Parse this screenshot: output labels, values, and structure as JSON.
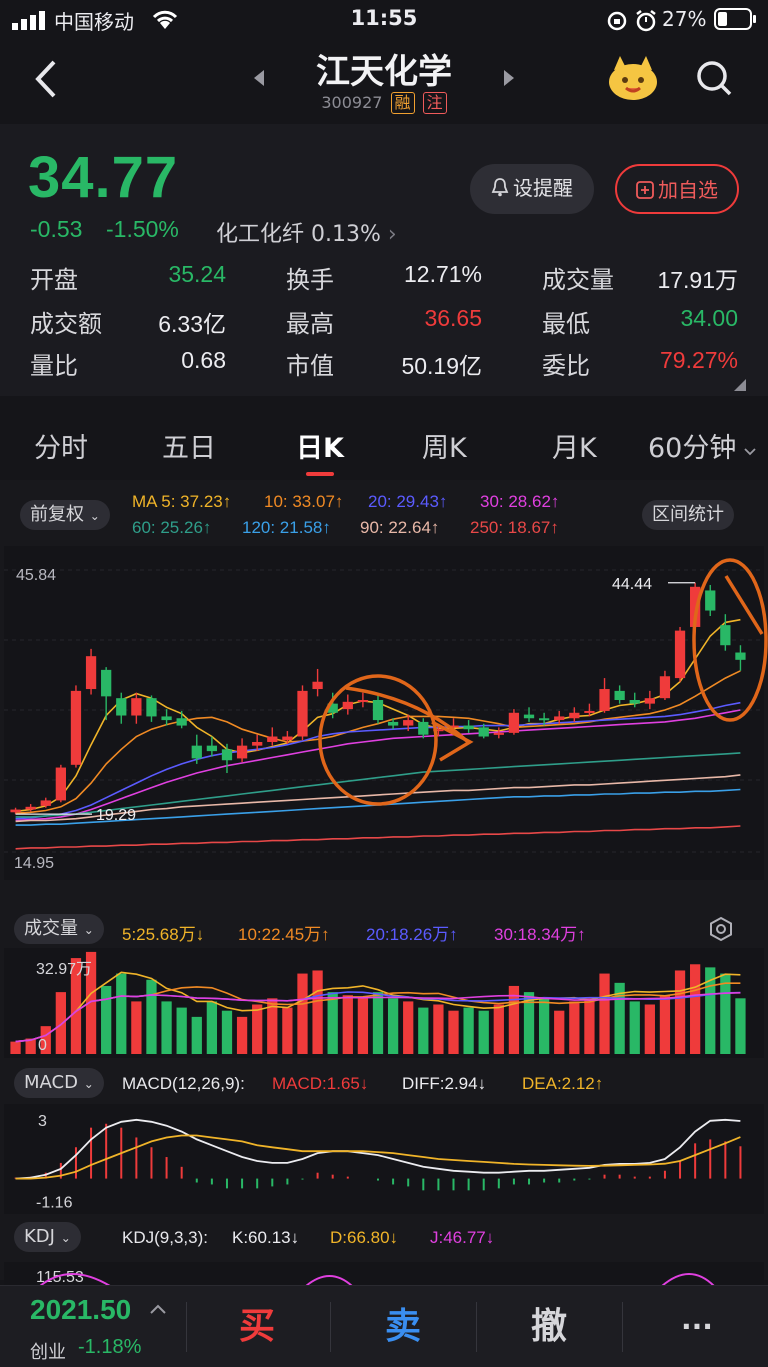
{
  "status_bar": {
    "carrier": "中国移动",
    "time": "11:55",
    "battery": "27%"
  },
  "header": {
    "title": "江天化学",
    "code": "300927",
    "tag_margin": "融",
    "tag_note": "注",
    "icons": [
      "back-arrow-icon",
      "prev-stock-icon",
      "next-stock-icon",
      "mascot-icon",
      "search-icon"
    ]
  },
  "quote": {
    "price": "34.77",
    "change": "-0.53",
    "change_pct": "-1.50%",
    "sector": "化工化纤",
    "sector_pct": "0.13%",
    "alert_btn": "设提醒",
    "watch_btn": "加自选",
    "stats": [
      {
        "label": "开盘",
        "value": "35.24",
        "color": "green"
      },
      {
        "label": "换手",
        "value": "12.71%",
        "color": "white"
      },
      {
        "label": "成交量",
        "value": "17.91万",
        "color": "white"
      },
      {
        "label": "成交额",
        "value": "6.33亿",
        "color": "white"
      },
      {
        "label": "最高",
        "value": "36.65",
        "color": "red"
      },
      {
        "label": "最低",
        "value": "34.00",
        "color": "green"
      },
      {
        "label": "量比",
        "value": "0.68",
        "color": "white"
      },
      {
        "label": "市值",
        "value": "50.19亿",
        "color": "white"
      },
      {
        "label": "委比",
        "value": "79.27%",
        "color": "red"
      }
    ]
  },
  "tabs": [
    "分时",
    "五日",
    "日K",
    "周K",
    "月K",
    "60分钟"
  ],
  "active_tab": 2,
  "chart_controls": {
    "adjust": "前复权",
    "range_stats": "区间统计",
    "volume": "成交量",
    "macd": "MACD",
    "kdj": "KDJ"
  },
  "ma_legend": [
    {
      "text": "MA 5: 37.23↑",
      "color": "#f0b429"
    },
    {
      "text": "10: 33.07↑",
      "color": "#f08a24"
    },
    {
      "text": "20: 29.43↑",
      "color": "#5b5bff"
    },
    {
      "text": "30: 28.62↑",
      "color": "#e040e0"
    },
    {
      "text": "60: 25.26↑",
      "color": "#2f9e8a"
    },
    {
      "text": "120: 21.58↑",
      "color": "#3aa0e8"
    },
    {
      "text": "90: 22.64↑",
      "color": "#e8b8a8"
    },
    {
      "text": "250: 18.67↑",
      "color": "#e84848"
    }
  ],
  "vol_legend": [
    {
      "text": "5:25.68万↓",
      "color": "#f0b429"
    },
    {
      "text": "10:22.45万↑",
      "color": "#f08a24"
    },
    {
      "text": "20:18.26万↑",
      "color": "#5b5bff"
    },
    {
      "text": "30:18.34万↑",
      "color": "#e040e0"
    }
  ],
  "macd_legend": [
    {
      "text": "MACD(12,26,9):",
      "color": "#e8e8ec"
    },
    {
      "text": "MACD:1.65↓",
      "color": "#ef3b3b"
    },
    {
      "text": "DIFF:2.94↓",
      "color": "#ececf0"
    },
    {
      "text": "DEA:2.12↑",
      "color": "#f0b429"
    }
  ],
  "kdj_legend": [
    {
      "text": "KDJ(9,3,3):",
      "color": "#e8e8ec"
    },
    {
      "text": "K:60.13↓",
      "color": "#ececf0"
    },
    {
      "text": "D:66.80↓",
      "color": "#f0b429"
    },
    {
      "text": "J:46.77↓",
      "color": "#e040e0"
    }
  ],
  "axis_labels": {
    "price_top": "45.84",
    "price_bottom": "14.95",
    "price_high_mark": "44.44",
    "price_low_mark": "19.29",
    "vol_top": "32.97万",
    "vol_zero": "0",
    "macd_top": "3",
    "macd_bottom": "-1.16",
    "kdj_top": "115.53"
  },
  "chart_data": {
    "type": "candlestick",
    "ylim": [
      14.95,
      45.84
    ],
    "candles": [
      {
        "o": 19.3,
        "c": 19.6,
        "h": 19.8,
        "l": 19.1
      },
      {
        "o": 19.6,
        "c": 19.9,
        "h": 20.2,
        "l": 19.4
      },
      {
        "o": 20.0,
        "c": 20.6,
        "h": 20.9,
        "l": 19.8
      },
      {
        "o": 20.6,
        "c": 24.2,
        "h": 24.5,
        "l": 20.4
      },
      {
        "o": 24.5,
        "c": 32.6,
        "h": 33.2,
        "l": 24.2
      },
      {
        "o": 32.8,
        "c": 36.4,
        "h": 37.2,
        "l": 32.2
      },
      {
        "o": 34.9,
        "c": 32.0,
        "h": 35.2,
        "l": 29.4
      },
      {
        "o": 31.8,
        "c": 29.9,
        "h": 32.4,
        "l": 29.0
      },
      {
        "o": 29.9,
        "c": 31.8,
        "h": 32.4,
        "l": 29.0
      },
      {
        "o": 31.8,
        "c": 29.8,
        "h": 32.1,
        "l": 29.2
      },
      {
        "o": 29.8,
        "c": 29.4,
        "h": 30.6,
        "l": 28.8
      },
      {
        "o": 29.6,
        "c": 28.8,
        "h": 30.4,
        "l": 28.5
      },
      {
        "o": 26.6,
        "c": 25.2,
        "h": 27.8,
        "l": 24.6
      },
      {
        "o": 26.6,
        "c": 26.0,
        "h": 27.6,
        "l": 25.4
      },
      {
        "o": 26.2,
        "c": 25.0,
        "h": 26.8,
        "l": 23.6
      },
      {
        "o": 25.2,
        "c": 26.6,
        "h": 27.4,
        "l": 24.8
      },
      {
        "o": 26.6,
        "c": 27.0,
        "h": 27.8,
        "l": 26.0
      },
      {
        "o": 27.0,
        "c": 27.6,
        "h": 28.6,
        "l": 26.6
      },
      {
        "o": 27.2,
        "c": 27.6,
        "h": 28.2,
        "l": 26.8
      },
      {
        "o": 27.6,
        "c": 32.6,
        "h": 33.2,
        "l": 27.2
      },
      {
        "o": 32.8,
        "c": 33.6,
        "h": 35.0,
        "l": 32.0
      },
      {
        "o": 31.2,
        "c": 30.2,
        "h": 32.4,
        "l": 29.6
      },
      {
        "o": 30.6,
        "c": 31.4,
        "h": 32.2,
        "l": 30.0
      },
      {
        "o": 31.4,
        "c": 31.6,
        "h": 32.4,
        "l": 30.8
      },
      {
        "o": 31.6,
        "c": 29.4,
        "h": 32.2,
        "l": 29.0
      },
      {
        "o": 29.2,
        "c": 28.8,
        "h": 29.6,
        "l": 28.4
      },
      {
        "o": 28.8,
        "c": 29.4,
        "h": 30.0,
        "l": 28.2
      },
      {
        "o": 29.2,
        "c": 27.8,
        "h": 29.6,
        "l": 27.4
      },
      {
        "o": 28.2,
        "c": 28.4,
        "h": 29.0,
        "l": 27.6
      },
      {
        "o": 28.6,
        "c": 28.8,
        "h": 29.6,
        "l": 28.0
      },
      {
        "o": 28.8,
        "c": 28.4,
        "h": 29.4,
        "l": 28.0
      },
      {
        "o": 28.6,
        "c": 27.6,
        "h": 29.0,
        "l": 27.4
      },
      {
        "o": 27.8,
        "c": 28.0,
        "h": 28.6,
        "l": 27.4
      },
      {
        "o": 28.0,
        "c": 30.2,
        "h": 30.6,
        "l": 27.8
      },
      {
        "o": 30.0,
        "c": 29.6,
        "h": 30.8,
        "l": 29.2
      },
      {
        "o": 29.6,
        "c": 29.4,
        "h": 30.2,
        "l": 28.8
      },
      {
        "o": 29.4,
        "c": 29.8,
        "h": 30.4,
        "l": 29.0
      },
      {
        "o": 29.6,
        "c": 30.2,
        "h": 30.8,
        "l": 29.2
      },
      {
        "o": 30.2,
        "c": 30.4,
        "h": 31.2,
        "l": 29.8
      },
      {
        "o": 30.4,
        "c": 32.8,
        "h": 34.0,
        "l": 30.2
      },
      {
        "o": 32.6,
        "c": 31.6,
        "h": 33.2,
        "l": 31.2
      },
      {
        "o": 31.6,
        "c": 31.2,
        "h": 32.4,
        "l": 30.8
      },
      {
        "o": 31.2,
        "c": 31.8,
        "h": 32.6,
        "l": 30.6
      },
      {
        "o": 31.8,
        "c": 34.2,
        "h": 34.8,
        "l": 31.6
      },
      {
        "o": 34.0,
        "c": 39.2,
        "h": 39.6,
        "l": 33.6
      },
      {
        "o": 39.6,
        "c": 44.0,
        "h": 44.44,
        "l": 39.0
      },
      {
        "o": 43.6,
        "c": 41.4,
        "h": 44.2,
        "l": 40.8
      },
      {
        "o": 39.8,
        "c": 37.6,
        "h": 41.0,
        "l": 37.0
      },
      {
        "o": 36.8,
        "c": 36.0,
        "h": 37.6,
        "l": 34.8
      }
    ],
    "ma_series": [
      {
        "name": "MA5",
        "color": "#f0b429",
        "values": [
          19.4,
          19.6,
          20.0,
          21.0,
          23.3,
          26.7,
          29.9,
          31.6,
          32.3,
          31.8,
          30.8,
          30.1,
          28.6,
          27.6,
          26.2,
          25.8,
          26.1,
          26.5,
          26.9,
          28.2,
          29.7,
          30.1,
          31.1,
          31.5,
          31.3,
          30.6,
          29.9,
          28.9,
          28.5,
          28.5,
          28.6,
          28.4,
          28.2,
          28.6,
          29.0,
          29.0,
          29.5,
          29.8,
          29.9,
          30.5,
          31.0,
          31.2,
          31.6,
          32.2,
          33.6,
          36.1,
          38.6,
          40.1,
          40.4
        ]
      },
      {
        "name": "MA10",
        "color": "#f08a24",
        "values": [
          19.2,
          19.3,
          19.5,
          19.9,
          20.8,
          22.5,
          24.6,
          26.2,
          27.6,
          28.4,
          28.9,
          29.3,
          29.6,
          29.7,
          29.2,
          28.4,
          27.9,
          27.4,
          27.0,
          27.1,
          27.3,
          27.6,
          28.1,
          28.6,
          29.0,
          29.5,
          29.8,
          29.8,
          29.8,
          29.7,
          29.6,
          29.3,
          29.0,
          28.6,
          28.7,
          28.8,
          28.9,
          29.0,
          29.2,
          29.5,
          29.7,
          29.9,
          30.1,
          30.5,
          31.1,
          32.0,
          33.0,
          34.0,
          34.8
        ]
      },
      {
        "name": "MA20",
        "color": "#5b5bff",
        "values": [
          18.6,
          18.7,
          18.9,
          19.1,
          19.5,
          20.1,
          20.9,
          21.7,
          22.5,
          23.3,
          24.0,
          24.6,
          25.1,
          25.5,
          25.8,
          26.0,
          26.2,
          26.4,
          26.7,
          27.1,
          27.6,
          27.9,
          28.1,
          28.2,
          28.3,
          28.4,
          28.5,
          28.6,
          28.6,
          28.7,
          28.7,
          28.8,
          28.8,
          28.8,
          28.9,
          29.0,
          29.1,
          29.2,
          29.3,
          29.4,
          29.5,
          29.6,
          29.7,
          29.8,
          30.0,
          30.3,
          30.6,
          31.0,
          31.3
        ]
      },
      {
        "name": "MA30",
        "color": "#e040e0",
        "values": [
          18.4,
          18.5,
          18.6,
          18.8,
          19.1,
          19.6,
          20.2,
          20.8,
          21.4,
          22.0,
          22.6,
          23.1,
          23.6,
          24.0,
          24.4,
          24.7,
          25.0,
          25.3,
          25.6,
          25.9,
          26.2,
          26.5,
          26.8,
          27.0,
          27.2,
          27.4,
          27.5,
          27.6,
          27.7,
          27.8,
          27.9,
          28.0,
          28.1,
          28.2,
          28.3,
          28.4,
          28.5,
          28.6,
          28.7,
          28.8,
          28.9,
          29.0,
          29.1,
          29.2,
          29.4,
          29.6,
          29.9,
          30.2,
          30.5
        ]
      },
      {
        "name": "MA60",
        "color": "#2f9e8a",
        "values": [
          18.8,
          18.8,
          18.9,
          19.0,
          19.1,
          19.3,
          19.5,
          19.7,
          19.9,
          20.1,
          20.3,
          20.5,
          20.7,
          20.9,
          21.1,
          21.3,
          21.5,
          21.7,
          21.9,
          22.1,
          22.3,
          22.5,
          22.7,
          22.9,
          23.1,
          23.3,
          23.5,
          23.7,
          23.8,
          23.9,
          24.0,
          24.1,
          24.2,
          24.3,
          24.4,
          24.5,
          24.6,
          24.7,
          24.8,
          24.9,
          25.0,
          25.1,
          25.2,
          25.3,
          25.4,
          25.5,
          25.6,
          25.7,
          25.8
        ]
      },
      {
        "name": "MA120",
        "color": "#3aa0e8",
        "values": [
          17.9,
          17.9,
          18.0,
          18.0,
          18.1,
          18.2,
          18.3,
          18.4,
          18.5,
          18.6,
          18.7,
          18.8,
          18.9,
          19.0,
          19.1,
          19.2,
          19.3,
          19.4,
          19.5,
          19.6,
          19.7,
          19.8,
          19.9,
          20.0,
          20.1,
          20.2,
          20.3,
          20.4,
          20.5,
          20.6,
          20.7,
          20.8,
          20.9,
          21.0,
          21.0,
          21.1,
          21.1,
          21.2,
          21.2,
          21.3,
          21.3,
          21.4,
          21.4,
          21.5,
          21.5,
          21.6,
          21.6,
          21.7,
          21.8
        ]
      },
      {
        "name": "MA90",
        "color": "#e8b8a8",
        "values": [
          18.3,
          18.4,
          18.4,
          18.5,
          18.6,
          18.8,
          19.0,
          19.2,
          19.4,
          19.6,
          19.7,
          19.9,
          20.0,
          20.1,
          20.2,
          20.3,
          20.4,
          20.5,
          20.6,
          20.7,
          20.8,
          20.9,
          21.0,
          21.1,
          21.2,
          21.3,
          21.4,
          21.5,
          21.6,
          21.7,
          21.7,
          21.8,
          21.9,
          22.0,
          22.0,
          22.1,
          22.2,
          22.3,
          22.3,
          22.4,
          22.5,
          22.6,
          22.7,
          22.8,
          22.9,
          23.0,
          23.1,
          23.2,
          23.4
        ]
      },
      {
        "name": "MA250",
        "color": "#e84848",
        "values": [
          15.3,
          15.4,
          15.4,
          15.5,
          15.5,
          15.6,
          15.6,
          15.7,
          15.7,
          15.8,
          15.8,
          15.9,
          15.9,
          16.0,
          16.0,
          16.1,
          16.1,
          16.2,
          16.2,
          16.3,
          16.3,
          16.4,
          16.4,
          16.5,
          16.5,
          16.6,
          16.6,
          16.7,
          16.7,
          16.8,
          16.8,
          16.9,
          16.9,
          17.0,
          17.0,
          17.1,
          17.1,
          17.2,
          17.2,
          17.3,
          17.3,
          17.4,
          17.4,
          17.5,
          17.5,
          17.6,
          17.6,
          17.7,
          17.8
        ]
      }
    ],
    "volume": [
      4,
      5,
      9,
      20,
      31,
      33,
      22,
      26,
      17,
      24,
      17,
      15,
      12,
      17,
      14,
      12,
      16,
      18,
      15,
      26,
      27,
      20,
      19,
      18,
      20,
      18,
      17,
      15,
      16,
      14,
      15,
      14,
      16,
      22,
      20,
      18,
      14,
      17,
      18,
      26,
      23,
      17,
      16,
      19,
      27,
      29,
      28,
      26,
      18
    ],
    "macd_hist": [
      0.05,
      0.1,
      0.3,
      0.8,
      1.6,
      2.6,
      2.8,
      2.6,
      2.1,
      1.6,
      1.1,
      0.6,
      -0.2,
      -0.3,
      -0.5,
      -0.5,
      -0.5,
      -0.4,
      -0.3,
      -0.05,
      0.3,
      0.2,
      0.1,
      0.0,
      -0.1,
      -0.3,
      -0.4,
      -0.6,
      -0.6,
      -0.6,
      -0.6,
      -0.6,
      -0.5,
      -0.3,
      -0.3,
      -0.2,
      -0.2,
      -0.1,
      -0.05,
      0.2,
      0.2,
      0.1,
      0.1,
      0.4,
      0.9,
      1.8,
      2.0,
      1.9,
      1.65
    ],
    "diff": [
      0.0,
      0.05,
      0.2,
      0.5,
      1.2,
      2.0,
      2.6,
      2.9,
      3.0,
      2.9,
      2.7,
      2.4,
      2.0,
      1.7,
      1.4,
      1.1,
      0.9,
      0.8,
      0.8,
      1.0,
      1.3,
      1.4,
      1.4,
      1.3,
      1.2,
      1.0,
      0.8,
      0.6,
      0.5,
      0.4,
      0.35,
      0.3,
      0.3,
      0.35,
      0.4,
      0.4,
      0.45,
      0.5,
      0.55,
      0.7,
      0.75,
      0.75,
      0.8,
      1.0,
      1.6,
      2.4,
      2.95,
      3.0,
      2.94
    ],
    "dea": [
      0.0,
      0.0,
      0.05,
      0.15,
      0.35,
      0.7,
      1.0,
      1.3,
      1.6,
      1.9,
      2.1,
      2.2,
      2.2,
      2.1,
      2.0,
      1.9,
      1.7,
      1.6,
      1.5,
      1.4,
      1.4,
      1.4,
      1.4,
      1.4,
      1.35,
      1.3,
      1.2,
      1.1,
      1.0,
      0.95,
      0.9,
      0.85,
      0.8,
      0.75,
      0.72,
      0.7,
      0.68,
      0.66,
      0.65,
      0.66,
      0.68,
      0.7,
      0.72,
      0.76,
      0.9,
      1.2,
      1.5,
      1.8,
      2.12
    ]
  },
  "bottom_bar": {
    "index_value": "2021.50",
    "index_name": "创业",
    "index_pct": "-1.18%",
    "buy": "买",
    "sell": "卖",
    "cancel": "撤",
    "more": "···"
  },
  "colors": {
    "up": "#ef3b3b",
    "down": "#29b866",
    "annotation": "#e0661a"
  }
}
